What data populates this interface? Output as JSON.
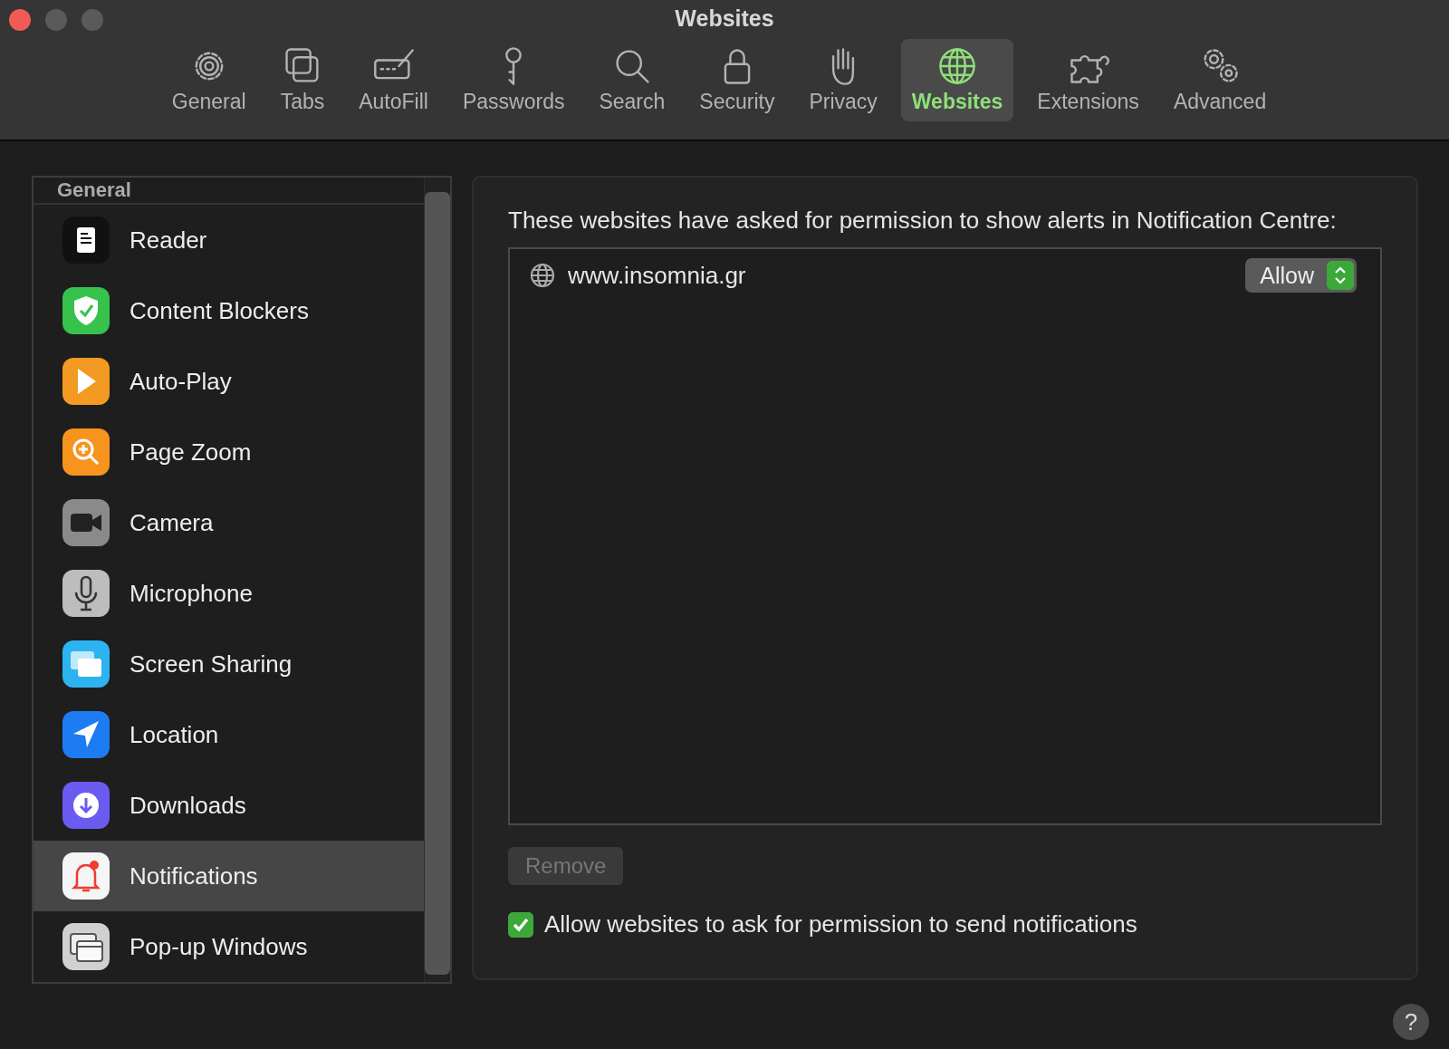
{
  "window": {
    "title": "Websites"
  },
  "toolbar": {
    "tabs": [
      {
        "label": "General",
        "kind": "gear",
        "selected": false
      },
      {
        "label": "Tabs",
        "kind": "tabs",
        "selected": false
      },
      {
        "label": "AutoFill",
        "kind": "pencil",
        "selected": false
      },
      {
        "label": "Passwords",
        "kind": "key",
        "selected": false
      },
      {
        "label": "Search",
        "kind": "search",
        "selected": false
      },
      {
        "label": "Security",
        "kind": "lock",
        "selected": false
      },
      {
        "label": "Privacy",
        "kind": "hand",
        "selected": false
      },
      {
        "label": "Websites",
        "kind": "globe",
        "selected": true
      },
      {
        "label": "Extensions",
        "kind": "puzzle",
        "selected": false
      },
      {
        "label": "Advanced",
        "kind": "gears",
        "selected": false
      }
    ]
  },
  "sidebar": {
    "header": "General",
    "items": [
      {
        "label": "Reader",
        "kind": "reader",
        "selected": false
      },
      {
        "label": "Content Blockers",
        "kind": "shield",
        "selected": false
      },
      {
        "label": "Auto-Play",
        "kind": "play",
        "selected": false
      },
      {
        "label": "Page Zoom",
        "kind": "zoom",
        "selected": false
      },
      {
        "label": "Camera",
        "kind": "camera",
        "selected": false
      },
      {
        "label": "Microphone",
        "kind": "mic",
        "selected": false
      },
      {
        "label": "Screen Sharing",
        "kind": "screens",
        "selected": false
      },
      {
        "label": "Location",
        "kind": "location",
        "selected": false
      },
      {
        "label": "Downloads",
        "kind": "download",
        "selected": false
      },
      {
        "label": "Notifications",
        "kind": "bell",
        "selected": true
      },
      {
        "label": "Pop-up Windows",
        "kind": "popup",
        "selected": false
      }
    ]
  },
  "panel": {
    "description": "These websites have asked for permission to show alerts in Notification Centre:",
    "sites": [
      {
        "domain": "www.insomnia.gr",
        "permission": "Allow"
      }
    ],
    "remove_button": {
      "label": "Remove",
      "disabled": true
    },
    "allow_checkbox": {
      "label": "Allow websites to ask for permission to send notifications",
      "checked": true
    }
  },
  "help_button": {
    "label": "?"
  }
}
